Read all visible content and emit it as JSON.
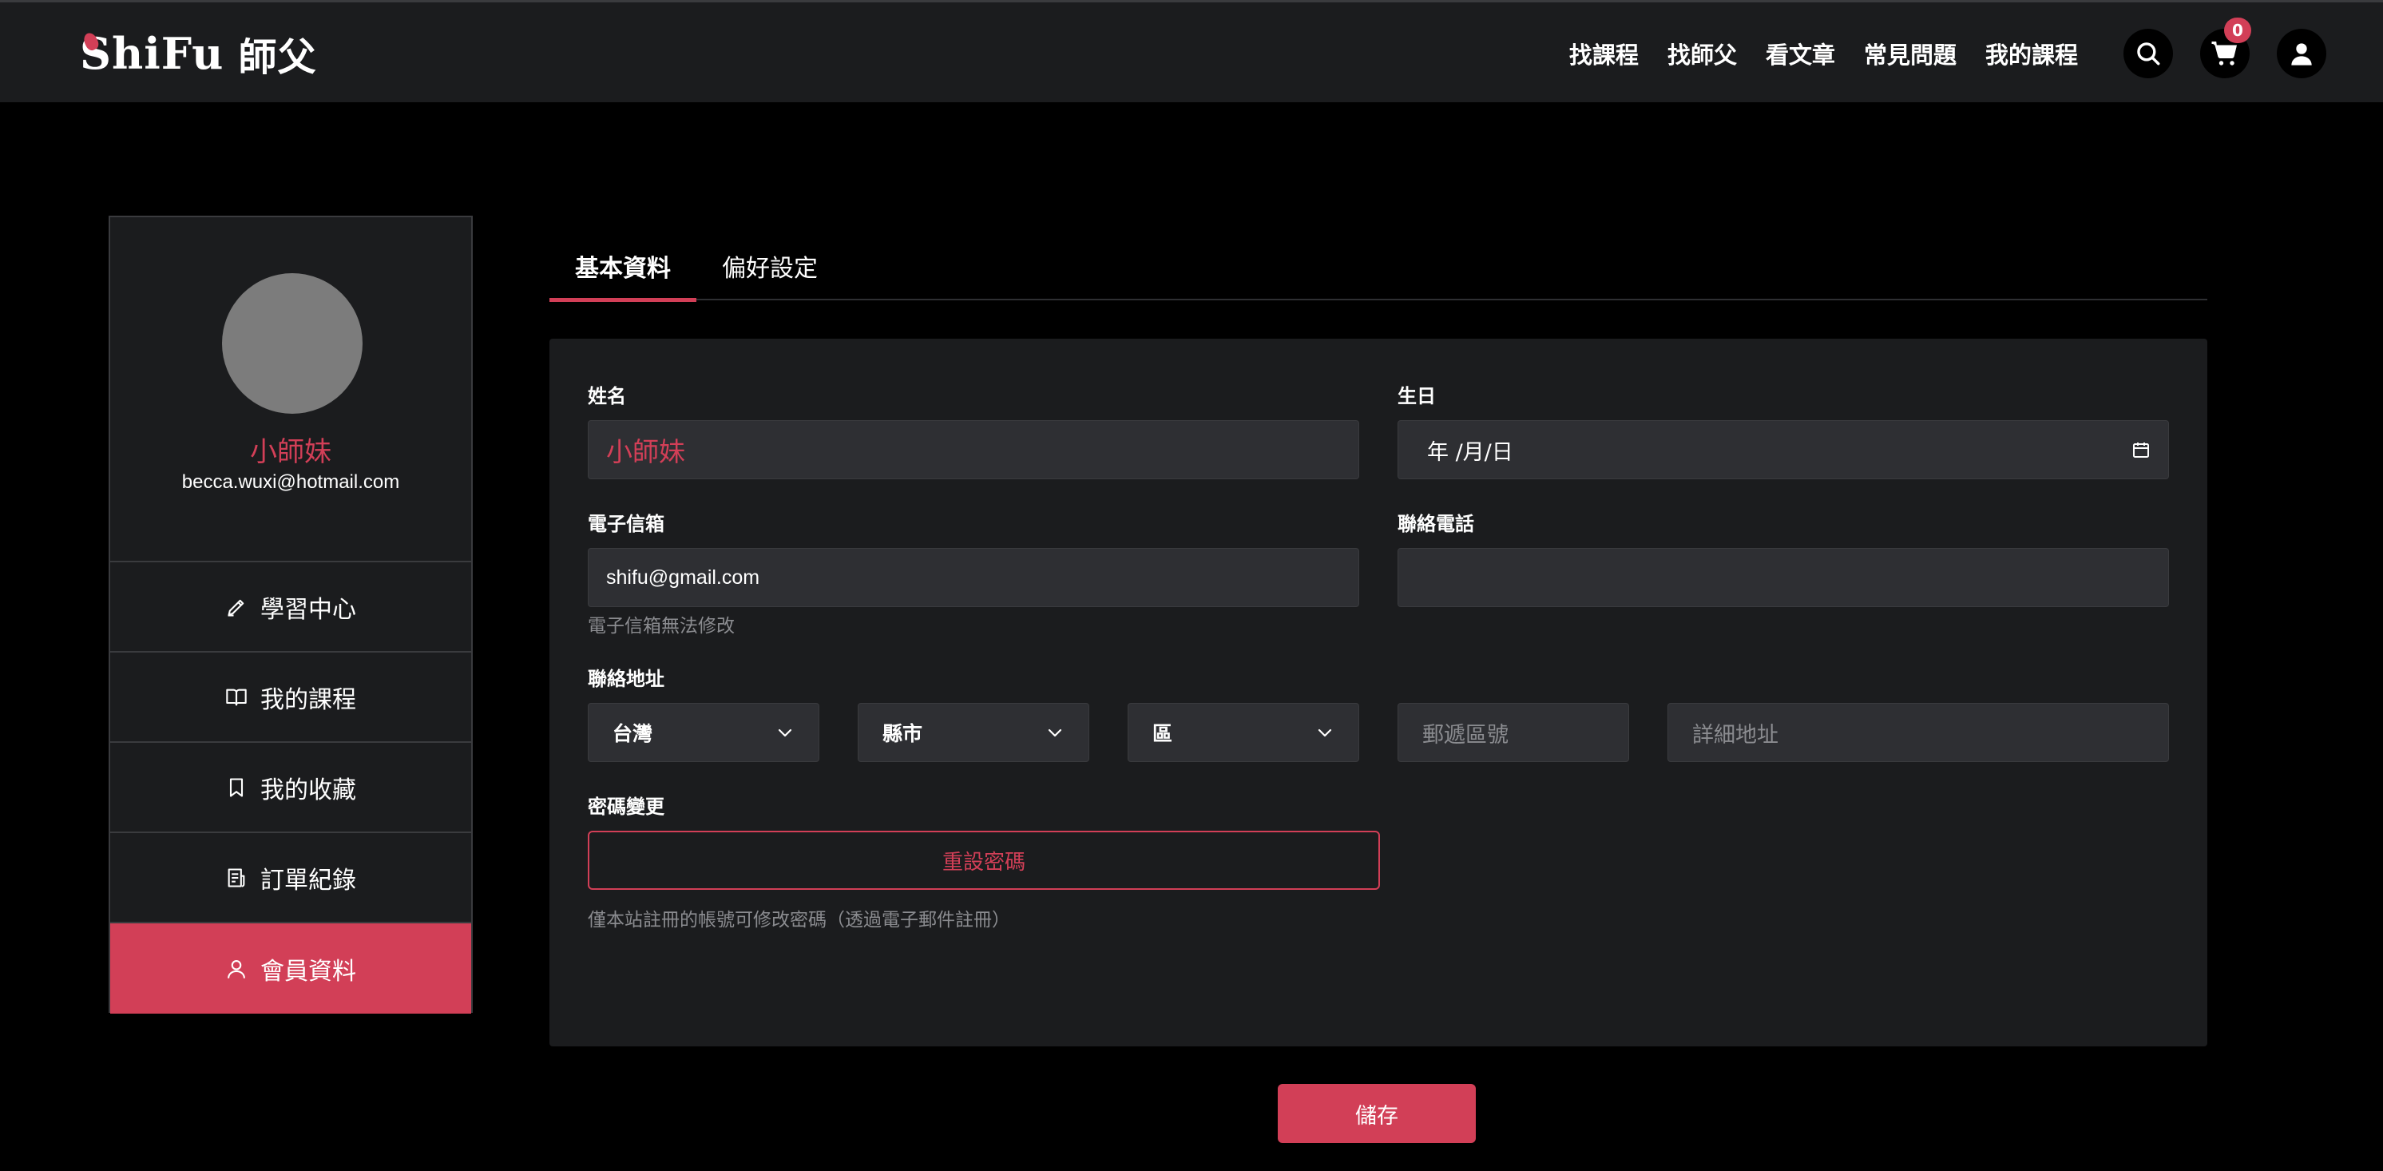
{
  "header": {
    "logo_en": "hiFu",
    "logo_s": "S",
    "logo_cn": "師父",
    "nav": [
      "找課程",
      "找師父",
      "看文章",
      "常見問題",
      "我的課程"
    ],
    "cart_count": "0"
  },
  "sidebar": {
    "name": "小師妹",
    "email": "becca.wuxi@hotmail.com",
    "items": [
      {
        "label": "學習中心",
        "icon": "pencil-icon"
      },
      {
        "label": "我的課程",
        "icon": "book-icon"
      },
      {
        "label": "我的收藏",
        "icon": "bookmark-icon"
      },
      {
        "label": "訂單紀錄",
        "icon": "receipt-icon"
      },
      {
        "label": "會員資料",
        "icon": "user-icon",
        "active": true
      }
    ]
  },
  "tabs": [
    {
      "label": "基本資料",
      "active": true
    },
    {
      "label": "偏好設定",
      "active": false
    }
  ],
  "form": {
    "name_label": "姓名",
    "name_value": "小師妹",
    "birthday_label": "生日",
    "birthday_value": "年 /月/日",
    "email_label": "電子信箱",
    "email_value": "shifu@gmail.com",
    "email_hint": "電子信箱無法修改",
    "phone_label": "聯絡電話",
    "phone_value": "",
    "address_label": "聯絡地址",
    "country": "台灣",
    "city": "縣市",
    "district": "區",
    "zip_placeholder": "郵遞區號",
    "address_placeholder": "詳細地址",
    "password_label": "密碼變更",
    "reset_button": "重設密碼",
    "password_hint": "僅本站註冊的帳號可修改密碼（透過電子郵件註冊）"
  },
  "save_button": "儲存",
  "colors": {
    "accent": "#d23f57",
    "header_bg": "#1b1c1e",
    "card_bg": "#1b1c1e",
    "input_bg": "#2e2f33"
  }
}
